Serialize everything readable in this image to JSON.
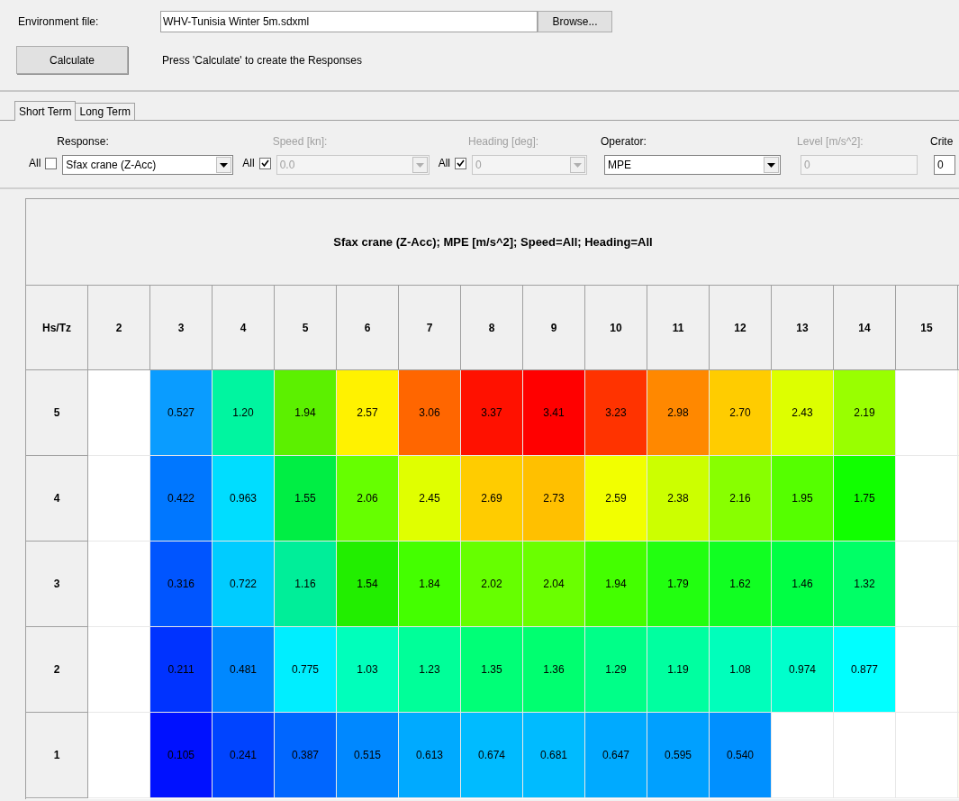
{
  "environment": {
    "label": "Environment file:",
    "value": "WHV-Tunisia Winter 5m.sdxml",
    "browse": "Browse..."
  },
  "calculate": {
    "button": "Calculate",
    "hint": "Press 'Calculate' to create the Responses"
  },
  "tabs": [
    {
      "label": "Short Term",
      "selected": true
    },
    {
      "label": "Long Term",
      "selected": false
    }
  ],
  "filters": [
    {
      "kind": "combo",
      "all_label": "All",
      "all_checked": false,
      "label": "Response:",
      "value": "Sfax crane (Z-Acc)",
      "disabled": false
    },
    {
      "kind": "combo",
      "all_label": "All",
      "all_checked": true,
      "label": "Speed [kn]:",
      "value": "0.0",
      "disabled": true
    },
    {
      "kind": "combo",
      "all_label": "All",
      "all_checked": true,
      "label": "Heading [deg]:",
      "value": "0",
      "disabled": true
    },
    {
      "kind": "combo",
      "label": "Operator:",
      "value": "MPE",
      "disabled": false
    },
    {
      "kind": "text",
      "label": "Level [m/s^2]:",
      "value": "0",
      "disabled": true
    },
    {
      "kind": "text",
      "label": "Crite",
      "value": "0",
      "disabled": false
    }
  ],
  "grid": {
    "title": "Sfax crane (Z-Acc); MPE [m/s^2]; Speed=All; Heading=All",
    "corner": "Hs/Tz",
    "columns": [
      "2",
      "3",
      "4",
      "5",
      "6",
      "7",
      "8",
      "9",
      "10",
      "11",
      "12",
      "13",
      "14",
      "15"
    ],
    "rows": [
      {
        "label": "5",
        "cells": [
          null,
          {
            "value": "0.527",
            "color": "#0a9cff"
          },
          {
            "value": "1.20",
            "color": "#00f5a0"
          },
          {
            "value": "1.94",
            "color": "#5cf000"
          },
          {
            "value": "2.57",
            "color": "#fff200"
          },
          {
            "value": "3.06",
            "color": "#ff6600"
          },
          {
            "value": "3.37",
            "color": "#ff1100"
          },
          {
            "value": "3.41",
            "color": "#ff0000"
          },
          {
            "value": "3.23",
            "color": "#ff3300"
          },
          {
            "value": "2.98",
            "color": "#ff8800"
          },
          {
            "value": "2.70",
            "color": "#ffcc00"
          },
          {
            "value": "2.43",
            "color": "#ddff00"
          },
          {
            "value": "2.19",
            "color": "#99ff00"
          },
          null
        ]
      },
      {
        "label": "4",
        "cells": [
          null,
          {
            "value": "0.422",
            "color": "#0077ff"
          },
          {
            "value": "0.963",
            "color": "#00ddff"
          },
          {
            "value": "1.55",
            "color": "#00ee44"
          },
          {
            "value": "2.06",
            "color": "#66ff00"
          },
          {
            "value": "2.45",
            "color": "#e0ff00"
          },
          {
            "value": "2.69",
            "color": "#ffcc00"
          },
          {
            "value": "2.73",
            "color": "#ffc000"
          },
          {
            "value": "2.59",
            "color": "#f2ff00"
          },
          {
            "value": "2.38",
            "color": "#ccff00"
          },
          {
            "value": "2.16",
            "color": "#88ff00"
          },
          {
            "value": "1.95",
            "color": "#55ff00"
          },
          {
            "value": "1.75",
            "color": "#11ff00"
          },
          null
        ]
      },
      {
        "label": "3",
        "cells": [
          null,
          {
            "value": "0.316",
            "color": "#0055ff"
          },
          {
            "value": "0.722",
            "color": "#00ccff"
          },
          {
            "value": "1.16",
            "color": "#00ee99"
          },
          {
            "value": "1.54",
            "color": "#22ee00"
          },
          {
            "value": "1.84",
            "color": "#44ff00"
          },
          {
            "value": "2.02",
            "color": "#66ff00"
          },
          {
            "value": "2.04",
            "color": "#6aff00"
          },
          {
            "value": "1.94",
            "color": "#44ff00"
          },
          {
            "value": "1.79",
            "color": "#22ff10"
          },
          {
            "value": "1.62",
            "color": "#11ff22"
          },
          {
            "value": "1.46",
            "color": "#00ff44"
          },
          {
            "value": "1.32",
            "color": "#00ff66"
          },
          null
        ]
      },
      {
        "label": "2",
        "cells": [
          null,
          {
            "value": "0.211",
            "color": "#0033ff"
          },
          {
            "value": "0.481",
            "color": "#0088ff"
          },
          {
            "value": "0.775",
            "color": "#00eeff"
          },
          {
            "value": "1.03",
            "color": "#00ffbb"
          },
          {
            "value": "1.23",
            "color": "#00ff99"
          },
          {
            "value": "1.35",
            "color": "#00ff77"
          },
          {
            "value": "1.36",
            "color": "#00ff70"
          },
          {
            "value": "1.29",
            "color": "#00ff88"
          },
          {
            "value": "1.19",
            "color": "#00ffa0"
          },
          {
            "value": "1.08",
            "color": "#00ffbb"
          },
          {
            "value": "0.974",
            "color": "#00ffcc"
          },
          {
            "value": "0.877",
            "color": "#00ffff"
          },
          null
        ]
      },
      {
        "label": "1",
        "cells": [
          null,
          {
            "value": "0.105",
            "color": "#0011ff"
          },
          {
            "value": "0.241",
            "color": "#0044ff"
          },
          {
            "value": "0.387",
            "color": "#0066ff"
          },
          {
            "value": "0.515",
            "color": "#0088ff"
          },
          {
            "value": "0.613",
            "color": "#00aaff"
          },
          {
            "value": "0.674",
            "color": "#00bbff"
          },
          {
            "value": "0.681",
            "color": "#00bbff"
          },
          {
            "value": "0.647",
            "color": "#00aaff"
          },
          {
            "value": "0.595",
            "color": "#00a0ff"
          },
          {
            "value": "0.540",
            "color": "#0090ff"
          },
          null,
          null,
          null
        ]
      }
    ]
  }
}
